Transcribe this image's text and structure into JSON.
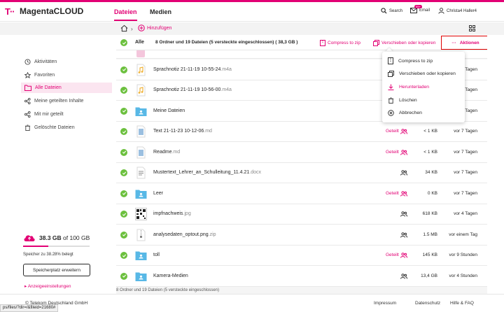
{
  "header": {
    "logo_t": "T··",
    "app_title": "MagentaCLOUD",
    "nav": [
      {
        "label": "Dateien"
      },
      {
        "label": "Medien"
      }
    ],
    "search_label": "Search",
    "email_label": "Email",
    "email_badge": "99+",
    "user_label": "Christa4 Haller4"
  },
  "toolbar": {
    "add_label": "Hinzufügen"
  },
  "sidebar": {
    "items": [
      {
        "label": "Aktivitäten"
      },
      {
        "label": "Favoriten"
      },
      {
        "label": "Alle Dateien"
      },
      {
        "label": "Meine geteilten Inhalte"
      },
      {
        "label": "Mit mir geteilt"
      },
      {
        "label": "Gelöschte Dateien"
      }
    ],
    "storage_used": "38.3 GB",
    "storage_of": " of 100 GB",
    "storage_percent": 38.28,
    "storage_note": "Speicher zu 38.28% belegt",
    "upgrade_label": "Speicherplatz erweitern",
    "display_settings": "Anzeigeeinstellungen"
  },
  "list": {
    "all_label": "Alle",
    "summary": "8 Ordner und 19 Dateien (5 versteckte eingeschlossen) ( 38,3 GB )",
    "compress_label": "Compress to zip",
    "move_label": "Verschieben oder kopieren",
    "actions_label": "Aktionen",
    "rows": [
      {
        "name": "Sprachnotiz 21-11-19 10-55-24",
        "ext": ".m4a",
        "shared": "",
        "size": "",
        "date": "7 Tagen",
        "type": "audio"
      },
      {
        "name": "Sprachnotiz 21-11-19 10-56-00",
        "ext": ".m4a",
        "shared": "",
        "size": "",
        "date": "7 Tagen",
        "type": "audio"
      },
      {
        "name": "Meine Dateien",
        "ext": "",
        "shared": "",
        "size": "",
        "date": "7 Tagen",
        "type": "folder-shared"
      },
      {
        "name": "Text 21-11-23 10-12-06",
        "ext": ".md",
        "shared": "Geteilt",
        "size": "< 1 KB",
        "date": "vor 7 Tagen",
        "type": "doc"
      },
      {
        "name": "Readme",
        "ext": ".md",
        "shared": "Geteilt",
        "size": "< 1 KB",
        "date": "vor 7 Tagen",
        "type": "doc"
      },
      {
        "name": "Mustertext_Lehrer_an_Schulleitung_11.4.21",
        "ext": ".docx",
        "shared": "",
        "size": "34 KB",
        "date": "vor 7 Tagen",
        "type": "word"
      },
      {
        "name": "Leer",
        "ext": "",
        "shared": "Geteilt",
        "size": "0 KB",
        "date": "vor 7 Tagen",
        "type": "folder-shared"
      },
      {
        "name": "impfnachweis",
        "ext": ".jpg",
        "shared": "",
        "size": "618 KB",
        "date": "vor 4 Tagen",
        "type": "image"
      },
      {
        "name": "analysedaten_optout.png",
        "ext": ".zip",
        "shared": "",
        "size": "1.5 MB",
        "date": "vor einem Tag",
        "type": "zip"
      },
      {
        "name": "toll",
        "ext": "",
        "shared": "Geteilt",
        "size": "145 KB",
        "date": "vor 9 Stunden",
        "type": "folder-shared"
      },
      {
        "name": "Kamera-Medien",
        "ext": "",
        "shared": "",
        "size": "13,4 GB",
        "date": "vor 4 Stunden",
        "type": "folder-shared"
      }
    ],
    "footer_count": "8 Ordner und 19 Dateien (5 versteckte eingeschlossen)"
  },
  "dropdown": {
    "items": [
      {
        "label": "Compress to zip"
      },
      {
        "label": "Verschieben oder kopieren"
      },
      {
        "label": "Herunterladen"
      },
      {
        "label": "Löschen"
      },
      {
        "label": "Abbrechen"
      }
    ]
  },
  "footer": {
    "copyright": "© Telekom Deutschland GmbH",
    "links": [
      {
        "label": "Impressum"
      },
      {
        "label": "Datenschutz"
      },
      {
        "label": "Hilfe & FAQ"
      }
    ]
  },
  "statusbar": "ps/files/?dir=/&fileid=21680#",
  "colors": {
    "accent": "#e20074",
    "check": "#6cc03e",
    "highlight_border": "#e00000"
  }
}
